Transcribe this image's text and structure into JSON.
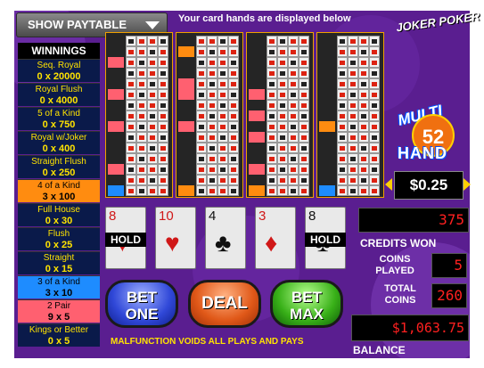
{
  "top_bar": {
    "paytable_label": "SHOW PAYTABLE",
    "hint": "Your card hands are displayed below"
  },
  "paytable": {
    "header": "WINNINGS",
    "rows": [
      {
        "name": "Seq. Royal",
        "payout": "0 x 20000",
        "color": "#0a1a4a",
        "text_color": "#ffe300"
      },
      {
        "name": "Royal Flush",
        "payout": "0 x 4000",
        "color": "#0a1a4a",
        "text_color": "#ffe300"
      },
      {
        "name": "5 of a Kind",
        "payout": "0 x 750",
        "color": "#0a1a4a",
        "text_color": "#ffe300"
      },
      {
        "name": "Royal w/Joker",
        "payout": "0 x 400",
        "color": "#0a1a4a",
        "text_color": "#ffe300"
      },
      {
        "name": "Straight Flush",
        "payout": "0 x 250",
        "color": "#0a1a4a",
        "text_color": "#ffe300"
      },
      {
        "name": "4 of a Kind",
        "payout": "3 x 100",
        "color": "#ff8c10",
        "text_color": "#000000"
      },
      {
        "name": "Full House",
        "payout": "0 x 30",
        "color": "#0a1a4a",
        "text_color": "#ffe300"
      },
      {
        "name": "Flush",
        "payout": "0 x 25",
        "color": "#0a1a4a",
        "text_color": "#ffe300"
      },
      {
        "name": "Straight",
        "payout": "0 x 15",
        "color": "#0a1a4a",
        "text_color": "#ffe300"
      },
      {
        "name": "3 of a Kind",
        "payout": "3 x 10",
        "color": "#1e8cff",
        "text_color": "#000000"
      },
      {
        "name": "2 Pair",
        "payout": "9 x 5",
        "color": "#ff6070",
        "text_color": "#000000"
      },
      {
        "name": "Kings or Better",
        "payout": "0 x 5",
        "color": "#0a1a4a",
        "text_color": "#ffe300"
      }
    ]
  },
  "logos": {
    "joker": "JOKER POKER",
    "multi": "MULTI",
    "number": "52",
    "hand": "HAND"
  },
  "denomination": "$0.25",
  "cards": [
    {
      "rank": "8",
      "suit": "♥",
      "color": "#d01818",
      "held": true
    },
    {
      "rank": "10",
      "suit": "♥",
      "color": "#d01818",
      "held": false
    },
    {
      "rank": "4",
      "suit": "♣",
      "color": "#111111",
      "held": false
    },
    {
      "rank": "3",
      "suit": "♦",
      "color": "#d01818",
      "held": false
    },
    {
      "rank": "8",
      "suit": "♣",
      "color": "#111111",
      "held": true
    }
  ],
  "hold_label": "HOLD",
  "buttons": {
    "bet_one": "BET ONE",
    "deal": "DEAL",
    "bet_max": "BET MAX"
  },
  "credits_won": {
    "label": "CREDITS WON",
    "value": "375"
  },
  "coins_played": {
    "label": "COINS PLAYED",
    "value": "5"
  },
  "total_coins": {
    "label": "TOTAL COINS",
    "value": "260"
  },
  "balance": {
    "label": "BALANCE",
    "value": "$1,063.75"
  },
  "disclaimer": "MALFUNCTION VOIDS ALL PLAYS AND PAYS",
  "colors": {
    "background": "#6a2aa0",
    "accent": "#ffe300",
    "hand_border": "#f0a000",
    "win_marker_pair": "#ff6070",
    "win_marker_quads": "#ff8c10",
    "win_marker_trips": "#1e8cff"
  }
}
